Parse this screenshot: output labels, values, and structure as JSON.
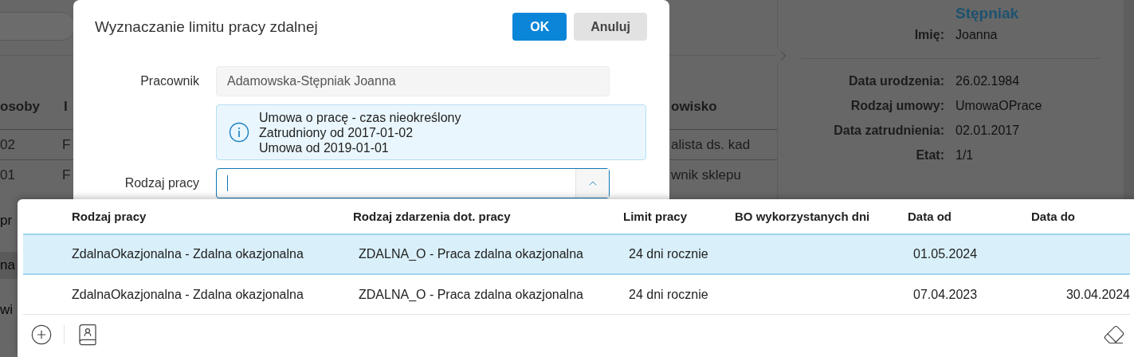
{
  "background": {
    "table": {
      "columns": [
        "osoby",
        "I",
        "owisko"
      ],
      "rows": [
        [
          "02",
          "F",
          "alista ds. kad"
        ],
        [
          "01",
          "F",
          "wnik sklepu"
        ]
      ]
    },
    "lower_rows": [
      {
        "text": "pr",
        "selected": false
      },
      {
        "text": "na",
        "selected": true
      },
      {
        "text": "wi",
        "selected": false
      }
    ],
    "details": {
      "surname": "Stępniak",
      "first_name": {
        "label": "Imię:",
        "value": "Joanna"
      },
      "fields": [
        {
          "label": "Data urodzenia:",
          "value": "26.02.1984"
        },
        {
          "label": "Rodzaj umowy:",
          "value": "UmowaOPrace"
        },
        {
          "label": "Data zatrudnienia:",
          "value": "02.01.2017"
        },
        {
          "label": "Etat:",
          "value": "1/1"
        }
      ]
    }
  },
  "dialog": {
    "title": "Wyznaczanie limitu pracy zdalnej",
    "buttons": [
      {
        "label": "OK",
        "kind": "primary"
      },
      {
        "label": "Anuluj",
        "kind": "secondary"
      }
    ],
    "employee": {
      "label": "Pracownik",
      "value": "Adamowska-Stępniak Joanna"
    },
    "info_lines": [
      "Umowa o pracę - czas nieokreślony",
      "Zatrudniony od 2017-01-02",
      "Umowa od 2019-01-01"
    ],
    "work_type": {
      "label": "Rodzaj pracy",
      "focused": true,
      "expanded": true
    }
  },
  "dropdown": {
    "columns": [
      "Rodzaj pracy",
      "Rodzaj zdarzenia dot. pracy",
      "Limit pracy",
      "BO wykorzystanych dni",
      "Data od",
      "Data do"
    ],
    "rows": [
      {
        "selected": true,
        "cells": [
          "ZdalnaOkazjonalna - Zdalna okazjonalna",
          "ZDALNA_O - Praca zdalna okazjonalna",
          "24 dni rocznie",
          null,
          "01.05.2024",
          null
        ]
      },
      {
        "selected": false,
        "cells": [
          "ZdalnaOkazjonalna - Zdalna okazjonalna",
          "ZDALNA_O - Praca zdalna okazjonalna",
          "24 dni rocznie",
          null,
          "07.04.2023",
          "30.04.2024"
        ]
      }
    ]
  }
}
